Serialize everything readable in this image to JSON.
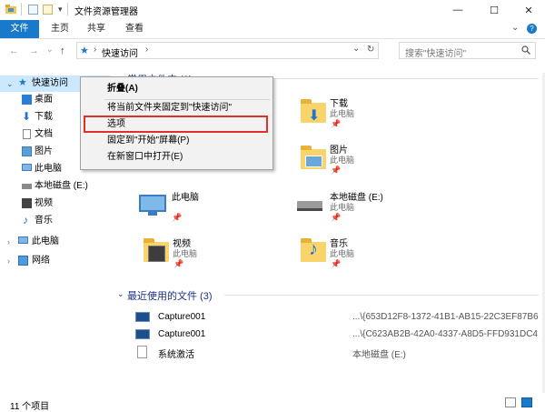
{
  "window": {
    "title": "文件资源管理器",
    "controls": {
      "minimize": "—",
      "maximize": "☐",
      "close": "✕"
    }
  },
  "ribbon": {
    "tabs": [
      {
        "label": "文件",
        "active": true
      },
      {
        "label": "主页",
        "active": false
      },
      {
        "label": "共享",
        "active": false
      },
      {
        "label": "查看",
        "active": false
      }
    ],
    "expand_icon": "chevron-down-icon",
    "help_icon": "help-icon"
  },
  "navbar": {
    "back": "←",
    "forward": "→",
    "recent": "⌄",
    "up": "↑",
    "path": [
      "快速访问"
    ],
    "separator": "›",
    "dropdown": "⌄",
    "refresh": "↻",
    "search_placeholder": "搜索\"快速访问\"",
    "search_icon": "search-icon"
  },
  "sidebar": {
    "quick_access": "快速访问",
    "items": [
      "桌面",
      "下载",
      "文档",
      "图片",
      "此电脑",
      "本地磁盘 (E:)",
      "视频",
      "音乐"
    ],
    "this_pc": "此电脑",
    "network": "网络"
  },
  "context_menu": {
    "items": [
      {
        "label": "折叠(A)",
        "bold": true
      },
      {
        "label": "将当前文件夹固定到\"快速访问\"",
        "bold": false
      },
      {
        "label": "选项",
        "bold": false,
        "highlighted": true
      },
      {
        "label": "固定到\"开始\"屏幕(P)",
        "bold": false
      },
      {
        "label": "在新窗口中打开(E)",
        "bold": false
      }
    ],
    "highlight_color": "#e0302c"
  },
  "content": {
    "frequent_group": "常用文件夹 (8)",
    "frequent": [
      {
        "name": "下载",
        "sub": "此电脑"
      },
      {
        "name": "图片",
        "sub": "此电脑"
      },
      {
        "name": "此电脑",
        "sub": ""
      },
      {
        "name": "本地磁盘 (E:)",
        "sub": "此电脑"
      },
      {
        "name": "视频",
        "sub": "此电脑"
      },
      {
        "name": "音乐",
        "sub": "此电脑"
      }
    ],
    "recent_group": "最近使用的文件 (3)",
    "recent": [
      {
        "name": "Capture001",
        "path": "...\\{653D12F8-1372-41B1-AB15-22C3EF87B6..."
      },
      {
        "name": "Capture001",
        "path": "...\\{C623AB2B-42A0-4337-A8D5-FFD931DC4..."
      },
      {
        "name": "系统激活",
        "path": "本地磁盘 (E:)"
      }
    ]
  },
  "statusbar": {
    "count": "11 个项目"
  },
  "colors": {
    "accent": "#1979ca",
    "selection": "#cce8ff",
    "group_title": "#1e3287",
    "folder": "#f3c552"
  }
}
